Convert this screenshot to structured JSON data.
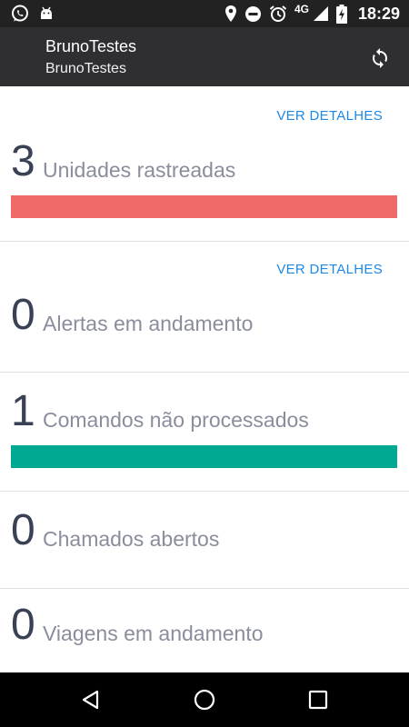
{
  "status_bar": {
    "network": "4G",
    "time": "18:29",
    "icons": [
      "whatsapp-icon",
      "android-icon",
      "location-icon",
      "do-not-disturb-icon",
      "alarm-icon",
      "signal-icon",
      "battery-charging-icon"
    ]
  },
  "toolbar": {
    "title": "BrunoTestes",
    "subtitle": "BrunoTestes",
    "refresh_icon": "refresh-icon"
  },
  "cards": [
    {
      "count": "3",
      "label": "Unidades rastreadas",
      "link": "VER DETALHES",
      "bar_color": "#ef6967",
      "bar_fill": 1.0
    },
    {
      "count": "0",
      "label": "Alertas em andamento",
      "link": "VER DETALHES"
    },
    {
      "count": "1",
      "label": "Comandos não processados",
      "bar_color": "#00a991",
      "bar_fill": 1.0
    },
    {
      "count": "0",
      "label": "Chamados abertos"
    },
    {
      "count": "0",
      "label": "Viagens em andamento"
    }
  ],
  "nav_bar": {
    "icons": [
      "back-icon",
      "home-icon",
      "recents-icon"
    ]
  },
  "colors": {
    "status_bar": "#222222",
    "toolbar": "#2f2f33",
    "link": "#1e88e5",
    "count": "#3a4155",
    "label": "#8a8d9c"
  }
}
